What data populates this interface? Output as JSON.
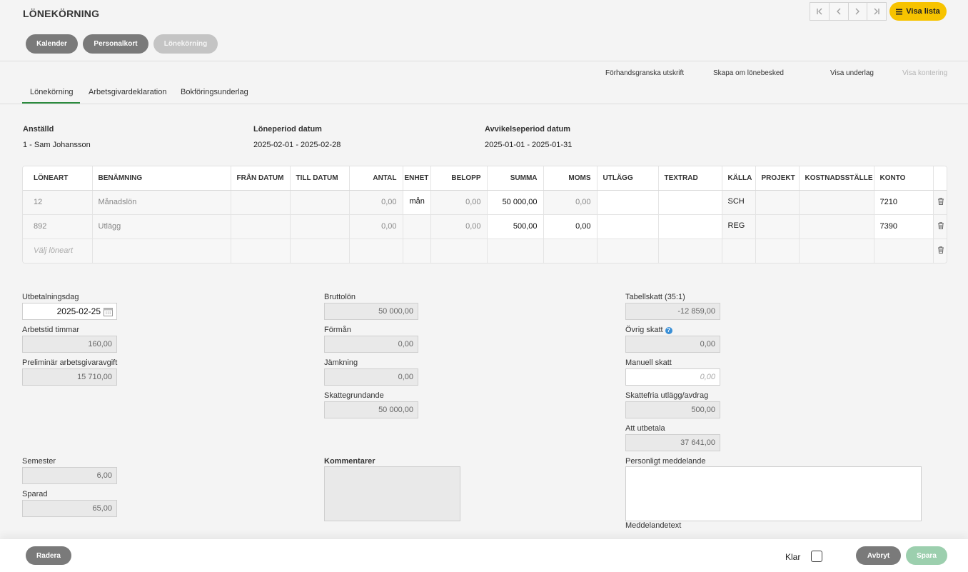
{
  "page": {
    "title": "LÖNEKÖRNING"
  },
  "toolbar": {
    "visa_lista": "Visa lista"
  },
  "nav_buttons": [
    "Kalender",
    "Personalkort",
    "Lönekörning"
  ],
  "actions": [
    "Förhandsgranska utskrift",
    "Skapa om lönebesked",
    "Visa underlag",
    "Visa kontering"
  ],
  "tabs": [
    "Lönekörning",
    "Arbetsgivardeklaration",
    "Bokföringsunderlag"
  ],
  "info": {
    "employee_label": "Anställd",
    "employee_value": "1 - Sam Johansson",
    "period_label": "Löneperiod datum",
    "period_value": "2025-02-01 - 2025-02-28",
    "deviation_label": "Avvikelseperiod datum",
    "deviation_value": "2025-01-01 - 2025-01-31"
  },
  "grid": {
    "headers": [
      "LÖNEART",
      "BENÄMNING",
      "FRÅN DATUM",
      "TILL DATUM",
      "ANTAL",
      "ENHET",
      "BELOPP",
      "SUMMA",
      "MOMS",
      "UTLÄGG",
      "TEXTRAD",
      "KÄLLA",
      "PROJEKT",
      "KOSTNADSSTÄLLE",
      "KONTO"
    ],
    "rows": [
      {
        "loneart": "12",
        "benamning": "Månadslön",
        "fran": "",
        "till": "",
        "antal": "0,00",
        "enhet": "mån",
        "belopp": "0,00",
        "summa": "50 000,00",
        "moms": "0,00",
        "utlagg": "",
        "textrad": "",
        "kalla": "SCH",
        "projekt": "",
        "kostnad": "",
        "konto": "7210"
      },
      {
        "loneart": "892",
        "benamning": "Utlägg",
        "fran": "",
        "till": "",
        "antal": "0,00",
        "enhet": "",
        "belopp": "0,00",
        "summa": "500,00",
        "moms": "0,00",
        "utlagg": "",
        "textrad": "",
        "kalla": "REG",
        "projekt": "",
        "kostnad": "",
        "konto": "7390"
      }
    ],
    "new_row_placeholder": "Välj löneart"
  },
  "fields": {
    "utbetalningsdag": {
      "label": "Utbetalningsdag",
      "value": "2025-02-25"
    },
    "arbetstid": {
      "label": "Arbetstid timmar",
      "value": "160,00"
    },
    "prelim": {
      "label": "Preliminär arbetsgivaravgift",
      "value": "15 710,00"
    },
    "bruttolon": {
      "label": "Bruttolön",
      "value": "50 000,00"
    },
    "forman": {
      "label": "Förmån",
      "value": "0,00"
    },
    "jamkning": {
      "label": "Jämkning",
      "value": "0,00"
    },
    "skattegrund": {
      "label": "Skattegrundande",
      "value": "50 000,00"
    },
    "tabellskatt": {
      "label": "Tabellskatt (35:1)",
      "value": "-12 859,00"
    },
    "ovrig": {
      "label": "Övrig skatt",
      "value": "0,00"
    },
    "manuell": {
      "label": "Manuell skatt",
      "placeholder": "0,00"
    },
    "skattefria": {
      "label": "Skattefria utlägg/avdrag",
      "value": "500,00"
    },
    "att_utbetala": {
      "label": "Att utbetala",
      "value": "37 641,00"
    },
    "semester": {
      "label": "Semester",
      "value": "6,00"
    },
    "sparad": {
      "label": "Sparad",
      "value": "65,00"
    },
    "kommentarer": {
      "label": "Kommentarer"
    },
    "personligt": {
      "label": "Personligt meddelande",
      "hint": "Meddelandetext"
    }
  },
  "footer": {
    "radera": "Radera",
    "klar": "Klar",
    "avbryt": "Avbryt",
    "spara": "Spara"
  },
  "colors": {
    "accent": "#f7c300",
    "tab_active": "#2b8a3e",
    "spara": "#9ccfae"
  }
}
